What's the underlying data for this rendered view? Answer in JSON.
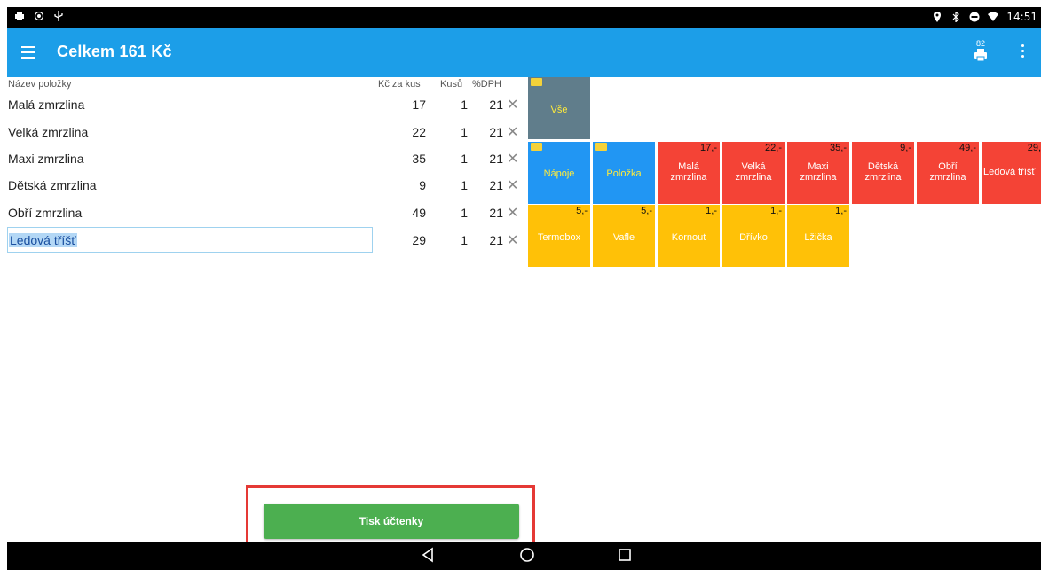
{
  "status_bar": {
    "time": "14:51",
    "left_icons": [
      "printer-icon",
      "record-icon",
      "usb-icon"
    ],
    "right_icons": [
      "location-icon",
      "bluetooth-icon",
      "do-not-disturb-icon",
      "wifi-icon"
    ]
  },
  "app_bar": {
    "title": "Celkem 161 Kč",
    "print_count": "82",
    "background": "#1c9ee8"
  },
  "list": {
    "headers": {
      "name": "Název položky",
      "price": "Kč za kus",
      "qty": "Kusů",
      "vat": "%DPH"
    },
    "rows": [
      {
        "name": "Malá zmrzlina",
        "price": "17",
        "qty": "1",
        "vat": "21"
      },
      {
        "name": "Velká zmrzlina",
        "price": "22",
        "qty": "1",
        "vat": "21"
      },
      {
        "name": "Maxi zmrzlina",
        "price": "35",
        "qty": "1",
        "vat": "21"
      },
      {
        "name": "Dětská zmrzlina",
        "price": "9",
        "qty": "1",
        "vat": "21"
      },
      {
        "name": "Obří zmrzlina",
        "price": "49",
        "qty": "1",
        "vat": "21"
      },
      {
        "name": "Ledová tříšť",
        "price": "29",
        "qty": "1",
        "vat": "21"
      }
    ],
    "remove_glyph": "✕"
  },
  "tiles": {
    "all": {
      "label": "Vše"
    },
    "row1": [
      {
        "label": "Nápoje",
        "price": ""
      },
      {
        "label": "Položka",
        "price": ""
      },
      {
        "label": "Malá\nzmrzlina",
        "price": "17,-"
      },
      {
        "label": "Velká\nzmrzlina",
        "price": "22,-"
      },
      {
        "label": "Maxi\nzmrzlina",
        "price": "35,-"
      },
      {
        "label": "Dětská\nzmrzlina",
        "price": "9,-"
      },
      {
        "label": "Obří\nzmrzlina",
        "price": "49,-"
      },
      {
        "label": "Ledová tříšť",
        "price": "29,"
      }
    ],
    "row2": [
      {
        "label": "Termobox",
        "price": "5,-"
      },
      {
        "label": "Vafle",
        "price": "5,-"
      },
      {
        "label": "Kornout",
        "price": "1,-"
      },
      {
        "label": "Dřívko",
        "price": "1,-"
      },
      {
        "label": "Lžička",
        "price": "1,-"
      }
    ]
  },
  "footer": {
    "print_receipt_label": "Tisk účtenky"
  },
  "nav": {
    "icons": [
      "back-icon",
      "home-icon",
      "recents-icon"
    ]
  }
}
